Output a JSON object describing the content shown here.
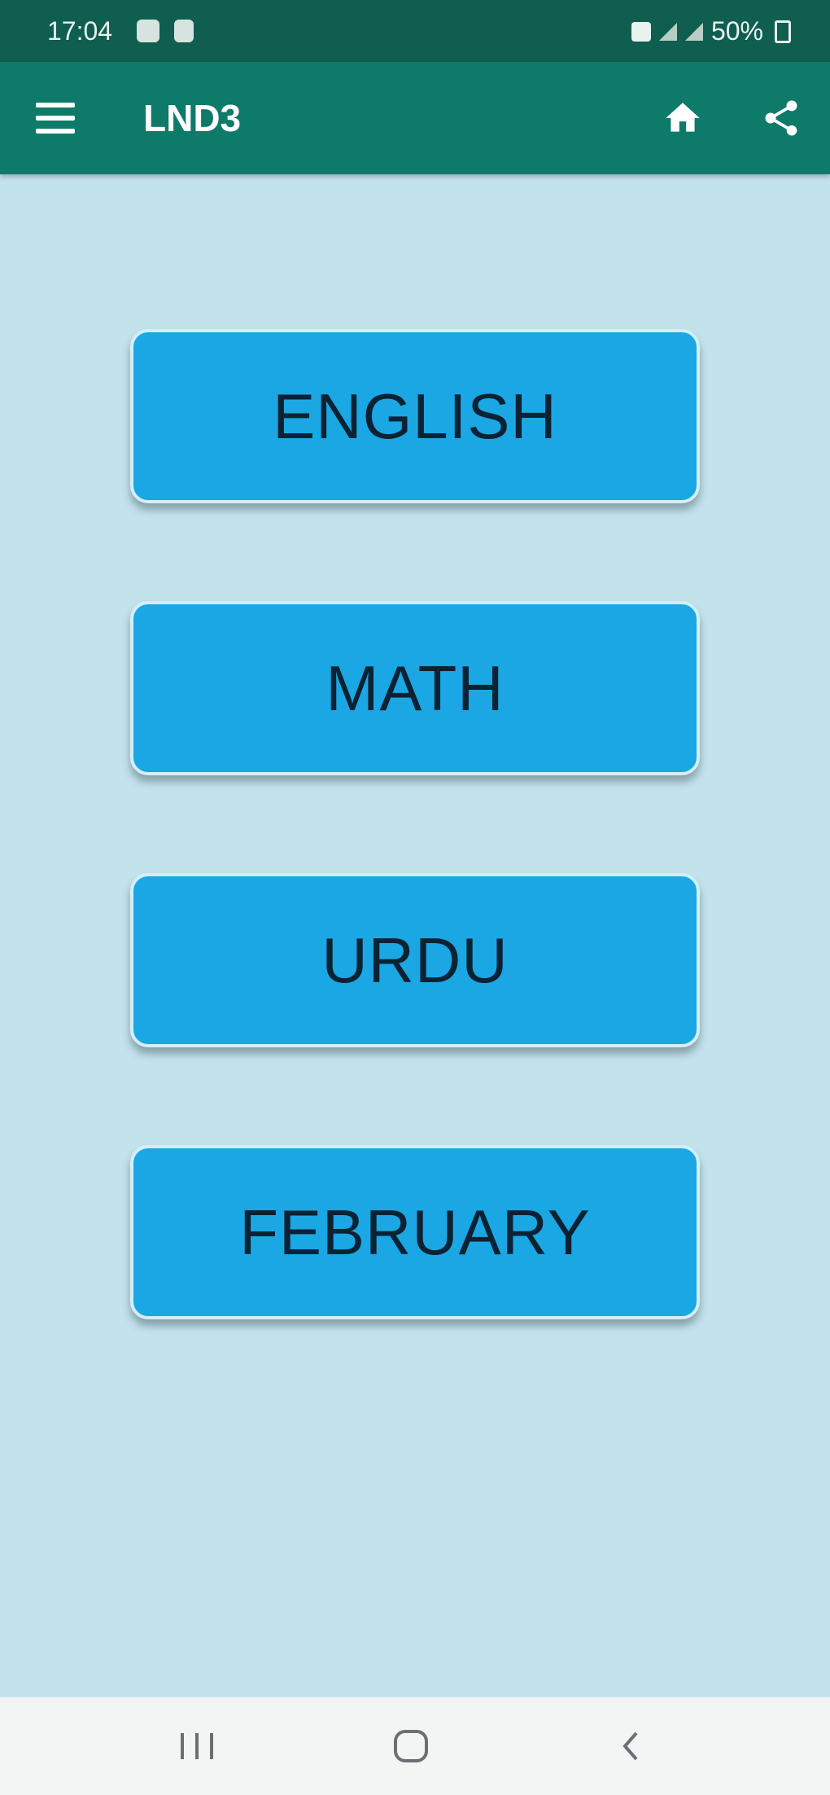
{
  "status_bar": {
    "time": "17:04",
    "battery": "50%"
  },
  "app_bar": {
    "title": "LND3",
    "icons": {
      "menu": "menu-icon",
      "home": "home-icon",
      "share": "share-icon"
    }
  },
  "subjects": [
    {
      "label": "ENGLISH"
    },
    {
      "label": "MATH"
    },
    {
      "label": "URDU"
    },
    {
      "label": "FEBRUARY"
    }
  ],
  "colors": {
    "status_bar": "#0f5e4f",
    "app_bar": "#0e7a69",
    "background": "#c3e3ec",
    "button": "#1aa7e3",
    "button_text": "#0a2233"
  },
  "nav_bar": {
    "icons": [
      "recents-icon",
      "home-circle-icon",
      "back-icon"
    ]
  }
}
